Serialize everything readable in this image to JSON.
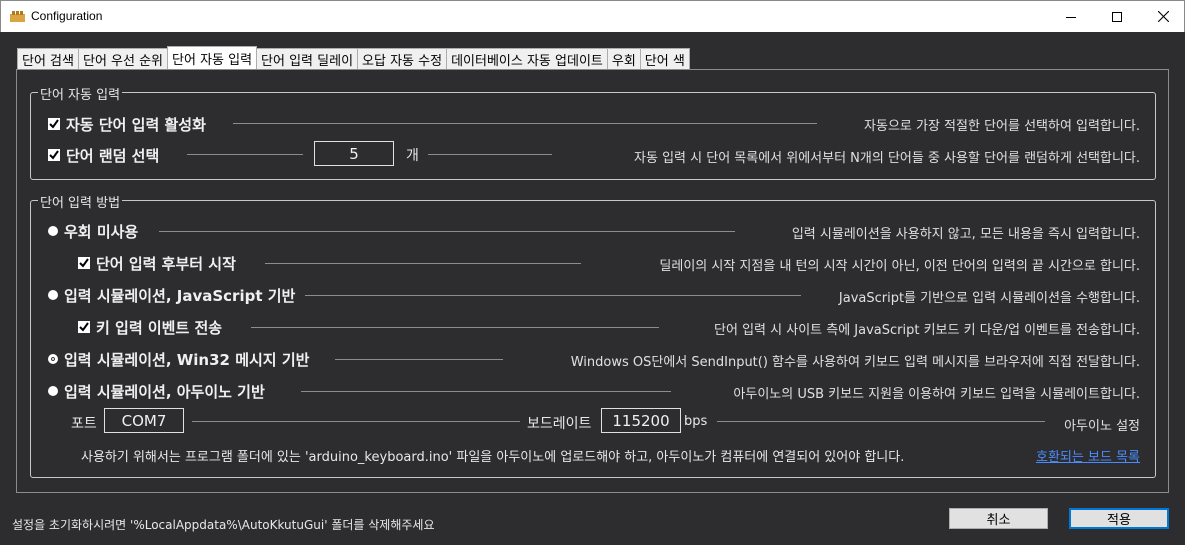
{
  "window": {
    "title": "Configuration",
    "minimize_icon": "minimize-icon",
    "maximize_icon": "maximize-icon",
    "close_icon": "close-icon"
  },
  "tabs": [
    {
      "label": "단어 검색"
    },
    {
      "label": "단어 우선 순위"
    },
    {
      "label": "단어 자동 입력",
      "active": true
    },
    {
      "label": "단어 입력 딜레이"
    },
    {
      "label": "오답 자동 수정"
    },
    {
      "label": "데이터베이스 자동 업데이트"
    },
    {
      "label": "우회"
    },
    {
      "label": "단어 색"
    }
  ],
  "auto_input_group": {
    "label": "단어 자동 입력",
    "enable": {
      "label": "자동 단어 입력 활성화",
      "checked": true,
      "desc": "자동으로 가장 적절한 단어를 선택하여 입력합니다."
    },
    "random": {
      "label": "단어 랜덤 선택",
      "checked": true,
      "count": "5",
      "unit": "개",
      "desc": "자동 입력 시 단어 목록에서 위에서부터 N개의 단어들 중 사용할 단어를 랜덤하게 선택합니다."
    }
  },
  "method_group": {
    "label": "단어 입력 방법",
    "no_bypass": {
      "label": "우회 미사용",
      "selected": false,
      "desc": "입력 시뮬레이션을 사용하지 않고, 모든 내용을 즉시 입력합니다."
    },
    "start_after": {
      "label": "단어 입력 후부터 시작",
      "checked": true,
      "desc": "딜레이의 시작 지점을 내 턴의 시작 시간이 아닌, 이전 단어의 입력의 끝 시간으로 합니다."
    },
    "js_sim": {
      "label": "입력 시뮬레이션, JavaScript 기반",
      "selected": false,
      "desc": "JavaScript를 기반으로 입력 시뮬레이션을 수행합니다."
    },
    "key_event": {
      "label": "키 입력 이벤트 전송",
      "checked": true,
      "desc": "단어 입력 시 사이트 측에 JavaScript 키보드 키 다운/업 이벤트를 전송합니다."
    },
    "win32_sim": {
      "label": "입력 시뮬레이션, Win32 메시지 기반",
      "selected": true,
      "desc": "Windows OS단에서 SendInput() 함수를 사용하여 키보드 입력 메시지를 브라우저에 직접 전달합니다."
    },
    "arduino_sim": {
      "label": "입력 시뮬레이션, 아두이노 기반",
      "selected": false,
      "desc": "아두이노의 USB 키보드 지원을 이용하여 키보드 입력을 시뮬레이트합니다."
    },
    "arduino": {
      "port_label": "포트",
      "port_value": "COM7",
      "baud_label": "보드레이트",
      "baud_value": "115200",
      "baud_unit": "bps",
      "settings_label": "아두이노 설정",
      "notice": "사용하기 위해서는 프로그램 폴더에 있는 'arduino_keyboard.ino' 파일을 아두이노에 업로드해야 하고, 아두이노가 컴퓨터에 연결되어 있어야 합니다.",
      "compatible_link": "호환되는 보드 목록"
    }
  },
  "footer": {
    "reset_hint": "설정을 초기화하시려면 '%LocalAppdata%\\AutoKkutuGui' 폴더를 삭제해주세요",
    "cancel": "취소",
    "apply": "적용"
  }
}
